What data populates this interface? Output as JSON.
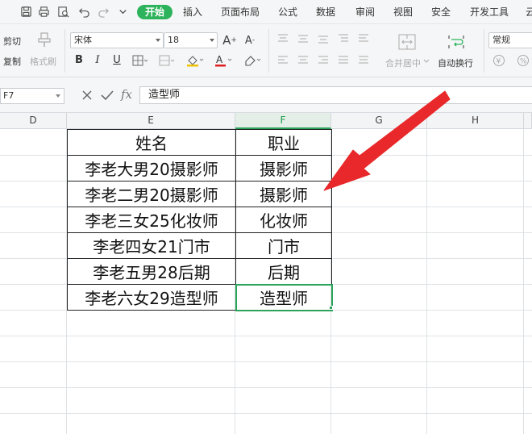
{
  "menubar": {
    "tabs": [
      "开始",
      "插入",
      "页面布局",
      "公式",
      "数据",
      "审阅",
      "视图",
      "安全",
      "开发工具",
      "云"
    ],
    "active_tab": 0
  },
  "ribbon": {
    "cut_label": "剪切",
    "copy_label": "复制",
    "format_painter_label": "格式刷",
    "font_name": "宋体",
    "font_size": "18",
    "merge_center_label": "合并居中",
    "wrap_text_label": "自动换行",
    "number_format": "常规"
  },
  "formula_bar": {
    "cell_ref": "F7",
    "content": "造型师"
  },
  "columns": [
    "D",
    "E",
    "F",
    "G",
    "H"
  ],
  "selected_column": "F",
  "table": {
    "rows": [
      [
        "姓名",
        "职业"
      ],
      [
        "李老大男20摄影师",
        "摄影师"
      ],
      [
        "李老二男20摄影师",
        "摄影师"
      ],
      [
        "李老三女25化妆师",
        "化妆师"
      ],
      [
        "李老四女21门市",
        "门市"
      ],
      [
        "李老五男28后期",
        "后期"
      ],
      [
        "李老六女29造型师",
        "造型师"
      ]
    ]
  },
  "colors": {
    "accent": "#2db35c",
    "arrow": "#e8282a",
    "selection": "#2ba35a"
  }
}
